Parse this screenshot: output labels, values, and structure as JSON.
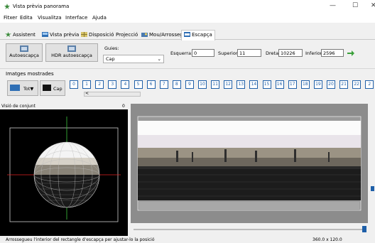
{
  "window": {
    "title": "Vista prèvia panorama",
    "minimize": "—",
    "maximize": "☐",
    "close": "✕"
  },
  "menu": [
    "Fitxer",
    "Edita",
    "Visualitza",
    "Interface",
    "Ajuda"
  ],
  "tabs": [
    {
      "label": "Assistent",
      "icon": "assistant-icon"
    },
    {
      "label": "Vista prèvia",
      "icon": "preview-icon"
    },
    {
      "label": "Disposició",
      "icon": "layout-icon"
    },
    {
      "label": "Projecció",
      "icon": "projection-icon"
    },
    {
      "label": "Mou/Arrossega",
      "icon": "drag-icon"
    },
    {
      "label": "Escapça",
      "icon": "crop-icon"
    }
  ],
  "toolbar": {
    "autocrop_label": "Autoescapça",
    "hdr_autocrop_label": "HDR autoescapça",
    "guides_label": "Guies:",
    "guides_value": "Cap",
    "left_label": "Esquerra:",
    "left_value": "0",
    "top_label": "Superior:",
    "top_value": "11",
    "right_label": "Dreta:",
    "right_value": "10226",
    "bottom_label": "Inferior:",
    "bottom_value": "2596"
  },
  "images": {
    "section_title": "Imatges mostrades",
    "all_label": "Tot▼",
    "none_label": "Cap",
    "numbers": [
      "0",
      "1",
      "2",
      "3",
      "4",
      "5",
      "6",
      "7",
      "8",
      "9",
      "10",
      "11",
      "12",
      "13",
      "14",
      "15",
      "16",
      "17",
      "18",
      "19",
      "20",
      "21",
      "22",
      "2"
    ]
  },
  "overview": {
    "title": "Visió de conjunt",
    "index": "0"
  },
  "status": {
    "message": "Arrossegueu l'interior del rectangle d'escapça per ajustar-lo la posició",
    "fov": "360.0 x 120.0"
  },
  "colors": {
    "accent": "#1e5fa8",
    "crop_box": "#d0d0d0",
    "guide_green": "#3fc63f",
    "guide_red": "#e02020"
  }
}
